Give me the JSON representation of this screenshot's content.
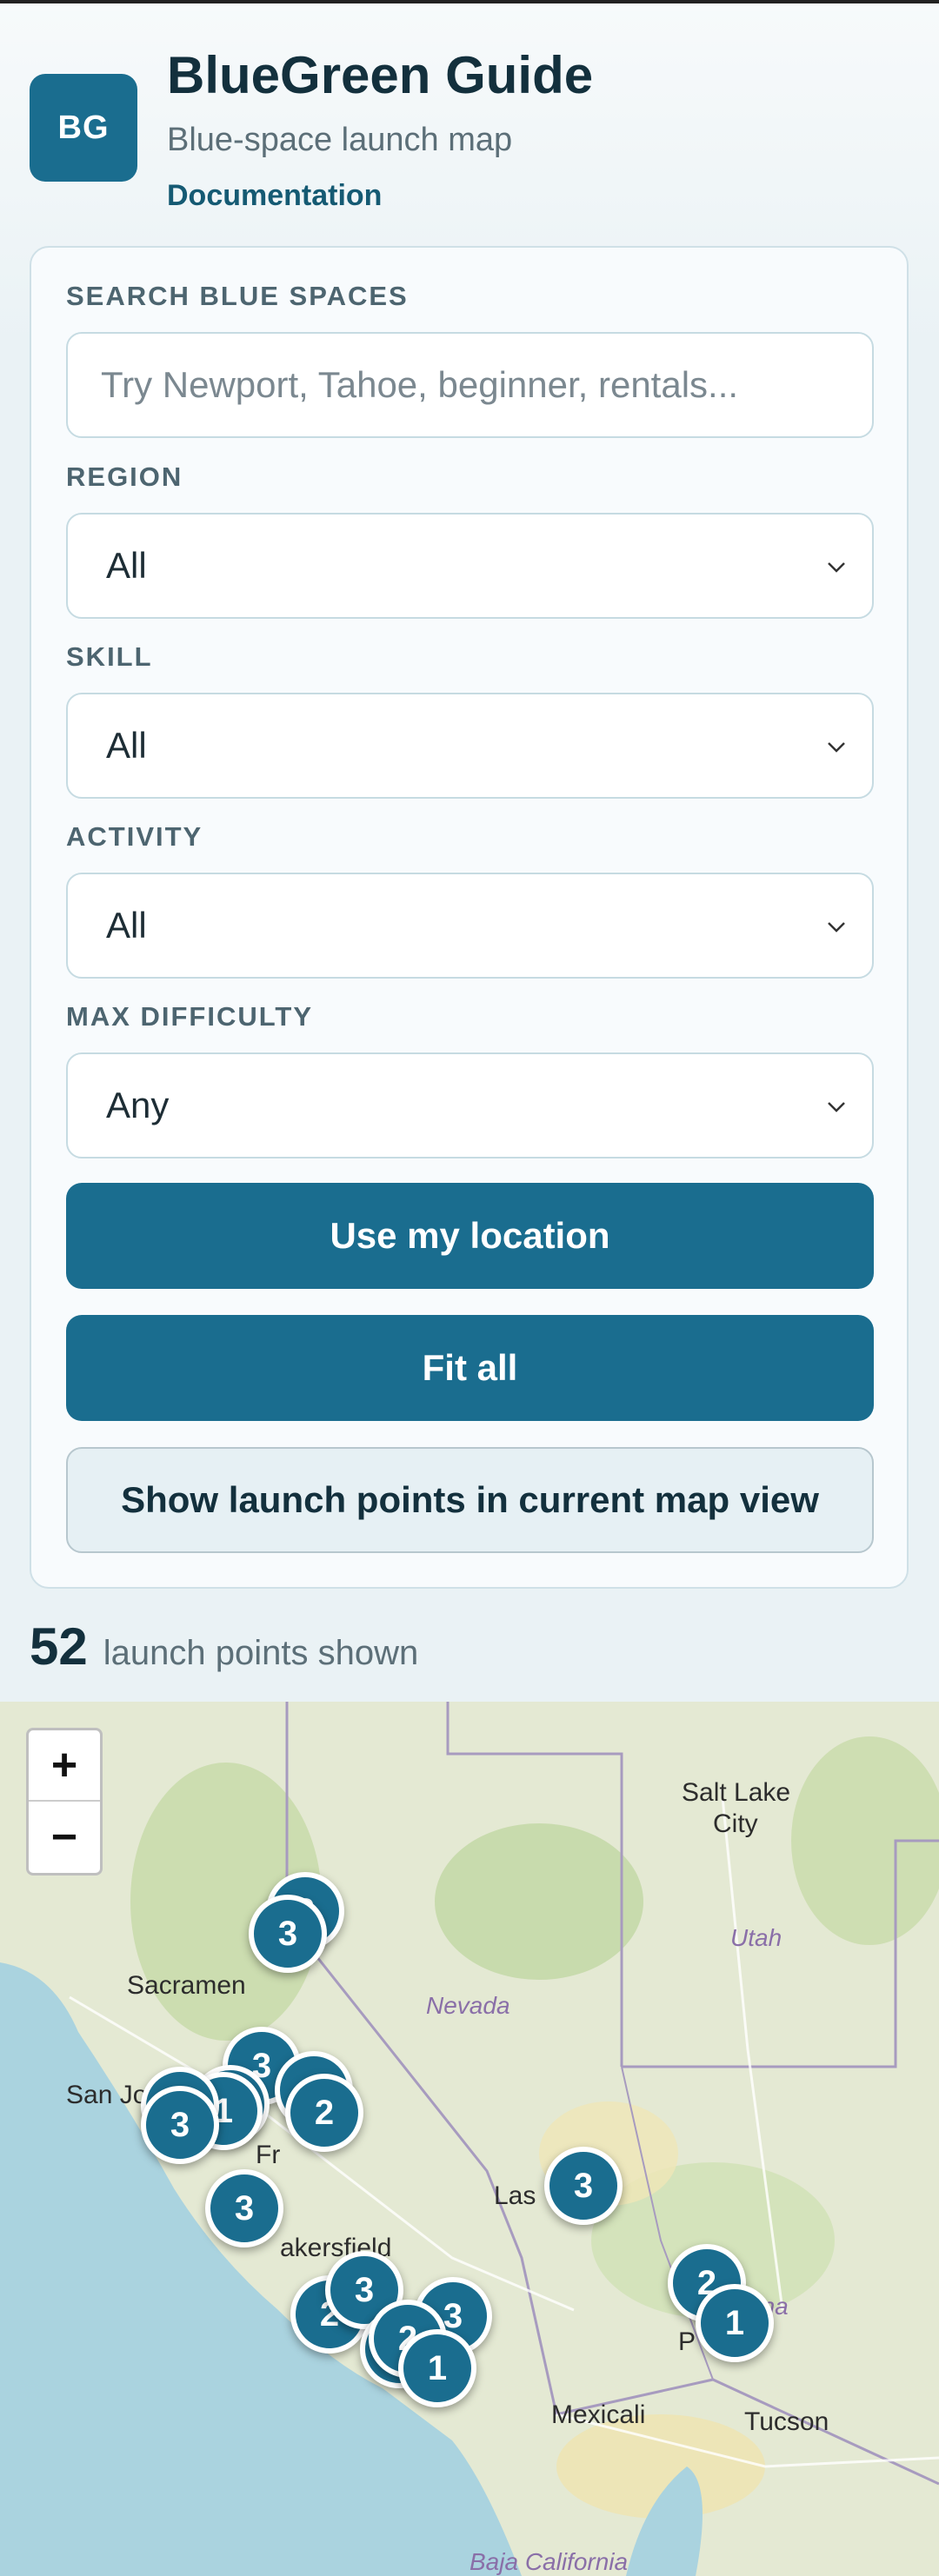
{
  "app": {
    "logo_text": "BG",
    "title": "BlueGreen Guide",
    "subtitle": "Blue-space launch map",
    "doc_link": "Documentation"
  },
  "filters": {
    "search_label": "SEARCH BLUE SPACES",
    "search_placeholder": "Try Newport, Tahoe, beginner, rentals...",
    "search_value": "",
    "region_label": "REGION",
    "region_value": "All",
    "skill_label": "SKILL",
    "skill_value": "All",
    "activity_label": "ACTIVITY",
    "activity_value": "All",
    "difficulty_label": "MAX DIFFICULTY",
    "difficulty_value": "Any"
  },
  "buttons": {
    "locate": "Use my location",
    "fit": "Fit all",
    "show_in_view": "Show launch points in current map view"
  },
  "results": {
    "count": "52",
    "count_text": "launch points shown"
  },
  "map": {
    "zoom_in": "+",
    "zoom_out": "−",
    "labels": {
      "salt_lake": "Salt Lake",
      "city": "City",
      "utah": "Utah",
      "nevada": "Nevada",
      "sacramento": "Sacramen",
      "san_jose": "San Jo",
      "las_vegas": "Las",
      "bakersfield": "akersfield",
      "fresno": "Fr",
      "mexicali": "Mexicali",
      "tucson": "Tucson",
      "phoenix": "P",
      "arizona": "ona",
      "baja": "Baja California"
    },
    "clusters": [
      "3",
      "3",
      "3",
      "2",
      "3",
      "1",
      "3",
      "3",
      "2",
      "3",
      "2",
      "3",
      "3",
      "3",
      "2",
      "1",
      "1",
      "2",
      "1"
    ],
    "colors": {
      "accent": "#1a6d8f",
      "water": "#aad3df"
    }
  }
}
